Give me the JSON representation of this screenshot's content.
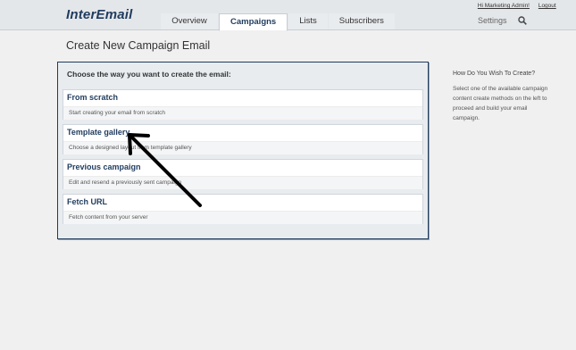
{
  "header": {
    "logo": "InterEmail",
    "user_link": "Hi Marketing Admin!",
    "logout_link": "Logout",
    "settings_label": "Settings",
    "tabs": [
      {
        "label": "Overview"
      },
      {
        "label": "Campaigns",
        "active": true
      },
      {
        "label": "Lists"
      },
      {
        "label": "Subscribers"
      }
    ]
  },
  "page": {
    "title": "Create New Campaign Email"
  },
  "panel": {
    "title": "Choose the way you want to create the email:",
    "options": [
      {
        "title": "From scratch",
        "description": "Start creating your email from scratch"
      },
      {
        "title": "Template gallery",
        "description": "Choose a designed layout from template gallery"
      },
      {
        "title": "Previous campaign",
        "description": "Edit and resend a previously sent campaign"
      },
      {
        "title": "Fetch URL",
        "description": "Fetch content from your server"
      }
    ]
  },
  "help": {
    "title": "How Do You Wish To Create?",
    "text": "Select one of the available campaign content create methods on the left to proceed and build your email campaign."
  },
  "icons": {
    "search": "search-icon",
    "annotation": "arrow-annotation"
  },
  "colors": {
    "brand": "#1f3b5e",
    "background": "#f0f0f0"
  }
}
